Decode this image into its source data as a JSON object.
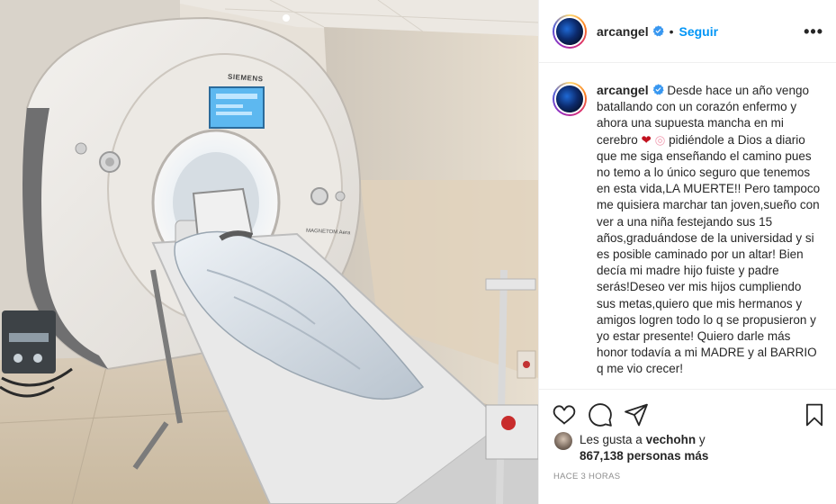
{
  "post": {
    "username": "arcangel",
    "separator": "•",
    "follow_label": "Seguir",
    "more_label": "•••",
    "caption": {
      "username": "arcangel",
      "text_part1": " Desde hace un año vengo batallando con un corazón enfermo y ahora una supuesta mancha en mi cerebro ",
      "emoji_heart": "❤",
      "emoji_brain": "◎",
      "text_part2": " pidiéndole a Dios a diario que me siga enseñando el camino pues no temo a lo único seguro que tenemos en esta vida,LA MUERTE!! Pero tampoco me quisiera marchar tan joven,sueño con ver a una niña festejando sus 15 años,graduándose de la universidad y si es posible caminado por un altar! Bien decía mi madre hijo fuiste y padre serás!Deseo ver mis hijos cumpliendo sus metas,quiero que mis hermanos y amigos logren todo lo q se propusieron y yo estar presente! Quiero darle más honor todavía a mi MADRE y al BARRIO q me vio crecer!"
    },
    "likes": {
      "prefix": "Les gusta a ",
      "liker": "vechohn",
      "middle": " y",
      "count": "867,138 personas más"
    },
    "timestamp": "HACE 3 HORAS"
  },
  "photo": {
    "machine_brand": "SIEMENS",
    "machine_model": "MAGNETOM Aera"
  },
  "icons": {
    "verified": "verified-badge-icon",
    "like": "heart-icon",
    "comment": "comment-icon",
    "share": "paper-plane-icon",
    "save": "bookmark-icon"
  },
  "colors": {
    "accent": "#0095f6",
    "verified": "#3897f0",
    "text": "#262626",
    "muted": "#8e8e8e"
  }
}
